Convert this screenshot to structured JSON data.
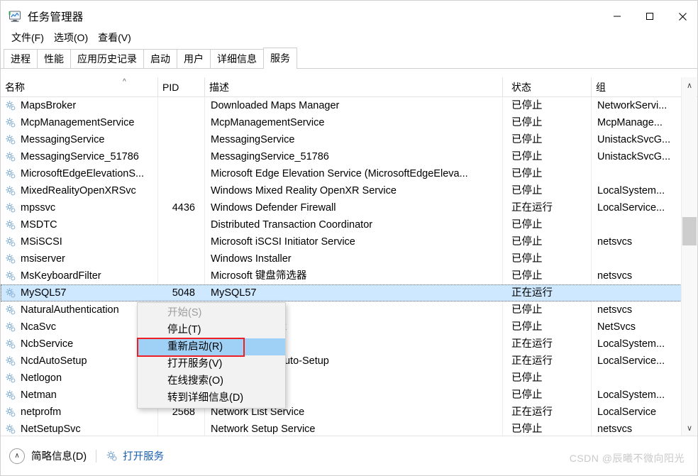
{
  "window": {
    "title": "任务管理器",
    "icon": "task-manager-icon",
    "minimize": "—",
    "maximize": "□",
    "close": "✕"
  },
  "menubar": {
    "items": [
      {
        "label": "文件(F)"
      },
      {
        "label": "选项(O)"
      },
      {
        "label": "查看(V)"
      }
    ]
  },
  "tabs": {
    "items": [
      {
        "label": "进程",
        "active": false
      },
      {
        "label": "性能",
        "active": false
      },
      {
        "label": "应用历史记录",
        "active": false
      },
      {
        "label": "启动",
        "active": false
      },
      {
        "label": "用户",
        "active": false
      },
      {
        "label": "详细信息",
        "active": false
      },
      {
        "label": "服务",
        "active": true
      }
    ]
  },
  "table": {
    "columns": [
      {
        "key": "name",
        "label": "名称",
        "sorted": "asc",
        "sort_glyph": "^"
      },
      {
        "key": "pid",
        "label": "PID"
      },
      {
        "key": "description",
        "label": "描述"
      },
      {
        "key": "status",
        "label": "状态"
      },
      {
        "key": "group",
        "label": "组"
      }
    ],
    "rows": [
      {
        "name": "MapsBroker",
        "pid": "",
        "description": "Downloaded Maps Manager",
        "status": "已停止",
        "group": "NetworkServi...",
        "selected": false
      },
      {
        "name": "McpManagementService",
        "pid": "",
        "description": "McpManagementService",
        "status": "已停止",
        "group": "McpManage...",
        "selected": false
      },
      {
        "name": "MessagingService",
        "pid": "",
        "description": "MessagingService",
        "status": "已停止",
        "group": "UnistackSvcG...",
        "selected": false
      },
      {
        "name": "MessagingService_51786",
        "pid": "",
        "description": "MessagingService_51786",
        "status": "已停止",
        "group": "UnistackSvcG...",
        "selected": false
      },
      {
        "name": "MicrosoftEdgeElevationS...",
        "pid": "",
        "description": "Microsoft Edge Elevation Service (MicrosoftEdgeEleva...",
        "status": "已停止",
        "group": "",
        "selected": false
      },
      {
        "name": "MixedRealityOpenXRSvc",
        "pid": "",
        "description": "Windows Mixed Reality OpenXR Service",
        "status": "已停止",
        "group": "LocalSystem...",
        "selected": false
      },
      {
        "name": "mpssvc",
        "pid": "4436",
        "description": "Windows Defender Firewall",
        "status": "正在运行",
        "group": "LocalService...",
        "selected": false
      },
      {
        "name": "MSDTC",
        "pid": "",
        "description": "Distributed Transaction Coordinator",
        "status": "已停止",
        "group": "",
        "selected": false
      },
      {
        "name": "MSiSCSI",
        "pid": "",
        "description": "Microsoft iSCSI Initiator Service",
        "status": "已停止",
        "group": "netsvcs",
        "selected": false
      },
      {
        "name": "msiserver",
        "pid": "",
        "description": "Windows Installer",
        "status": "已停止",
        "group": "",
        "selected": false
      },
      {
        "name": "MsKeyboardFilter",
        "pid": "",
        "description": "Microsoft 键盘筛选器",
        "status": "已停止",
        "group": "netsvcs",
        "selected": false
      },
      {
        "name": "MySQL57",
        "pid": "5048",
        "description": "MySQL57",
        "status": "正在运行",
        "group": "",
        "selected": true
      },
      {
        "name": "NaturalAuthentication",
        "pid": "",
        "description": "",
        "status": "已停止",
        "group": "netsvcs",
        "selected": false
      },
      {
        "name": "NcaSvc",
        "pid": "",
        "description": "ectivity Assistant",
        "status": "已停止",
        "group": "NetSvcs",
        "selected": false
      },
      {
        "name": "NcbService",
        "pid": "",
        "description": "ection Broker",
        "status": "正在运行",
        "group": "LocalSystem...",
        "selected": false
      },
      {
        "name": "NcdAutoSetup",
        "pid": "",
        "description": "ected Devices Auto-Setup",
        "status": "正在运行",
        "group": "LocalService...",
        "selected": false
      },
      {
        "name": "Netlogon",
        "pid": "",
        "description": "",
        "status": "已停止",
        "group": "",
        "selected": false
      },
      {
        "name": "Netman",
        "pid": "",
        "description": "ections",
        "status": "已停止",
        "group": "LocalSystem...",
        "selected": false
      },
      {
        "name": "netprofm",
        "pid": "2568",
        "description": "Network List Service",
        "status": "正在运行",
        "group": "LocalService",
        "selected": false
      },
      {
        "name": "NetSetupSvc",
        "pid": "",
        "description": "Network Setup Service",
        "status": "已停止",
        "group": "netsvcs",
        "selected": false
      }
    ]
  },
  "context_menu": {
    "items": [
      {
        "label": "开始(S)",
        "disabled": true,
        "highlighted": false
      },
      {
        "label": "停止(T)",
        "disabled": false,
        "highlighted": false
      },
      {
        "label": "重新启动(R)",
        "disabled": false,
        "highlighted": true
      },
      {
        "label": "打开服务(V)",
        "disabled": false,
        "highlighted": false
      },
      {
        "label": "在线搜索(O)",
        "disabled": false,
        "highlighted": false
      },
      {
        "label": "转到详细信息(D)",
        "disabled": false,
        "highlighted": false
      }
    ]
  },
  "statusbar": {
    "collapse_label": "简略信息(D)",
    "collapse_glyph": "∧",
    "open_services_label": "打开服务",
    "gear_icon": "gear-icon"
  },
  "scrollbar": {
    "up_glyph": "∧",
    "down_glyph": "∨"
  },
  "watermark": {
    "text": "CSDN @辰曦不微向阳光"
  },
  "colors": {
    "selection": "#cde8ff",
    "menu_highlight": "#9fd1f7",
    "red_box": "#ec2024",
    "link": "#1a5fb4",
    "watermark": "#c9c9c9"
  }
}
